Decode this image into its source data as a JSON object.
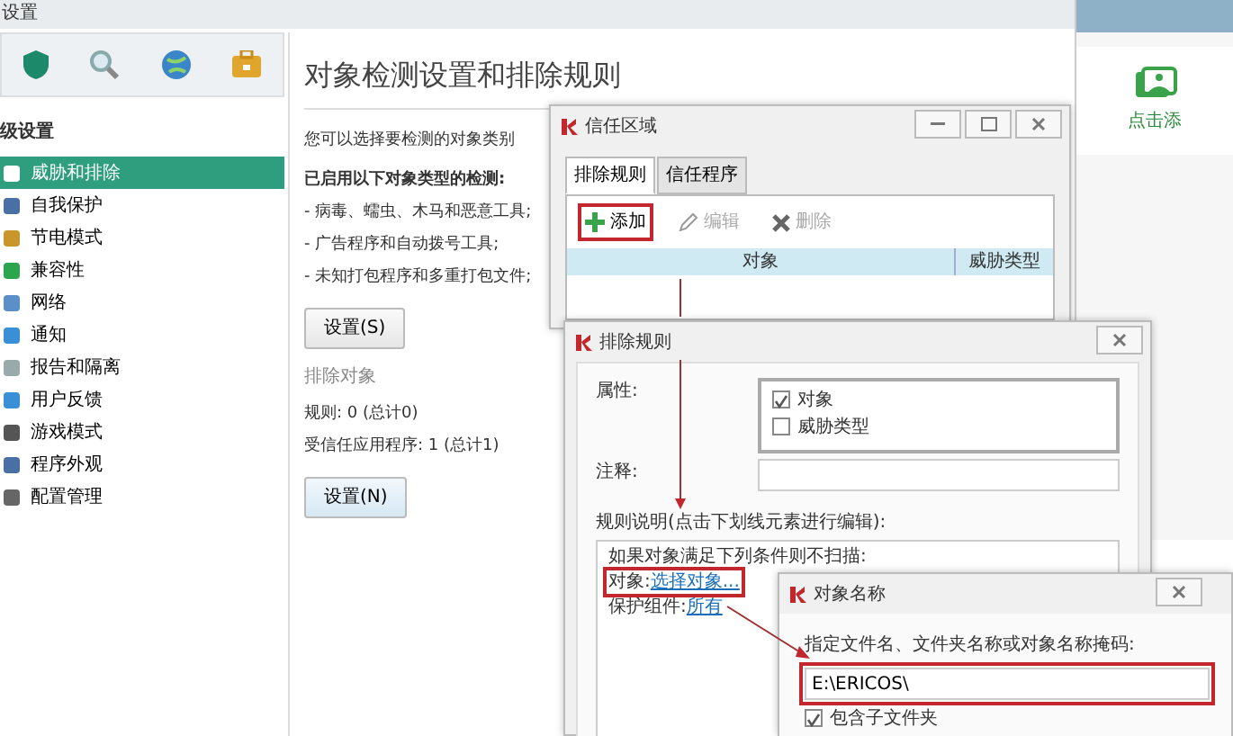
{
  "window": {
    "title": "设置"
  },
  "sidebar": {
    "heading": "级设置",
    "items": [
      {
        "label": "威胁和排除",
        "selected": true
      },
      {
        "label": "自我保护",
        "selected": false
      },
      {
        "label": "节电模式",
        "selected": false
      },
      {
        "label": "兼容性",
        "selected": false
      },
      {
        "label": "网络",
        "selected": false
      },
      {
        "label": "通知",
        "selected": false
      },
      {
        "label": "报告和隔离",
        "selected": false
      },
      {
        "label": "用户反馈",
        "selected": false
      },
      {
        "label": "游戏模式",
        "selected": false
      },
      {
        "label": "程序外观",
        "selected": false
      },
      {
        "label": "配置管理",
        "selected": false
      }
    ]
  },
  "main": {
    "title": "对象检测设置和排除规则",
    "description": "您可以选择要检测的对象类别",
    "enabled_heading": "已启用以下对象类型的检测:",
    "enabled_items": [
      "- 病毒、蠕虫、木马和恶意工具;",
      "- 广告程序和自动拨号工具;",
      "- 未知打包程序和多重打包文件;"
    ],
    "settings_button": "设置(S)",
    "exclusions_heading": "排除对象",
    "rules_count": "规则: 0 (总计0)",
    "trusted_count": "受信任应用程序: 1 (总计1)",
    "exclusions_button": "设置(N)"
  },
  "side_panel": {
    "add_label": "点击添"
  },
  "trusted_zone_dialog": {
    "title": "信任区域",
    "tabs": [
      {
        "label": "排除规则",
        "selected": true
      },
      {
        "label": "信任程序",
        "selected": false
      }
    ],
    "toolbar": [
      {
        "kind": "add",
        "label": "添加",
        "disabled": false,
        "highlighted": true
      },
      {
        "kind": "edit",
        "label": "编辑",
        "disabled": true,
        "highlighted": false
      },
      {
        "kind": "delete",
        "label": "删除",
        "disabled": true,
        "highlighted": false
      }
    ],
    "columns": [
      "对象",
      "威胁类型"
    ]
  },
  "rule_dialog": {
    "title": "排除规则",
    "properties_label": "属性:",
    "properties": [
      {
        "label": "对象",
        "checked": true
      },
      {
        "label": "威胁类型",
        "checked": false
      }
    ],
    "comment_label": "注释:",
    "description_label": "规则说明(点击下划线元素进行编辑):",
    "description_lines": [
      {
        "kind": "text",
        "text": "如果对象满足下列条件则不扫描:"
      },
      {
        "kind": "condition",
        "label": "对象:",
        "link": "选择对象...",
        "highlighted": true
      },
      {
        "kind": "condition",
        "label": "保护组件:",
        "link": "所有",
        "highlighted": false
      }
    ]
  },
  "object_dialog": {
    "title": "对象名称",
    "prompt": "指定文件名、文件夹名称或对象名称掩码:",
    "value": "E:\\ERICOS\\",
    "value_highlighted": true,
    "include_subfolders": {
      "label": "包含子文件夹",
      "checked": true
    }
  }
}
